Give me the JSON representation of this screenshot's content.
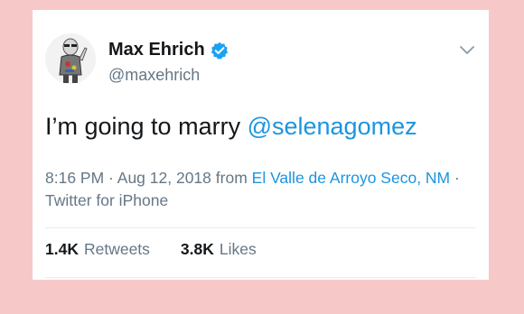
{
  "author": {
    "name": "Max Ehrich",
    "handle": "@maxehrich",
    "verified": true
  },
  "tweet": {
    "text": "I’m going to marry ",
    "mention": "@selenagomez"
  },
  "meta": {
    "time": "8:16 PM",
    "sep1": " · ",
    "date": "Aug 12, 2018",
    "from": " from ",
    "location": "El Valle de Arroyo Seco, NM",
    "sep2": " · ",
    "source": "Twitter for iPhone"
  },
  "stats": {
    "retweets_count": "1.4K",
    "retweets_label": "Retweets",
    "likes_count": "3.8K",
    "likes_label": "Likes"
  },
  "colors": {
    "background": "#f7c8c8",
    "link": "#1b95e0",
    "muted": "#657786",
    "text": "#14171a"
  },
  "icons": {
    "verified": "verified-badge-icon",
    "menu": "chevron-down-icon"
  }
}
